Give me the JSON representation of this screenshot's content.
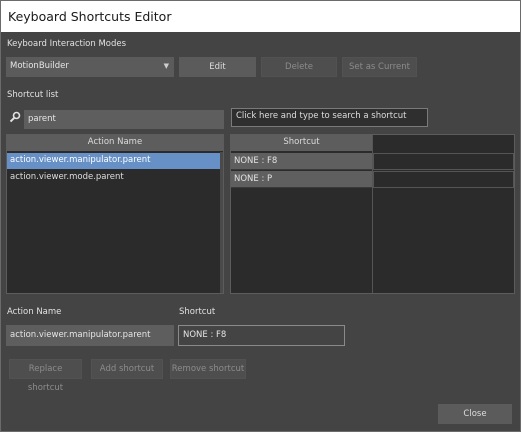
{
  "window": {
    "title": "Keyboard Shortcuts Editor"
  },
  "modes": {
    "label": "Keyboard Interaction Modes",
    "selected": "MotionBuilder",
    "edit_label": "Edit",
    "delete_label": "Delete",
    "set_current_label": "Set as Current"
  },
  "shortcut_list": {
    "label": "Shortcut list",
    "filter_value": "parent",
    "search_placeholder": "Click here and type to search a shortcut",
    "action_header": "Action Name",
    "shortcut_header": "Shortcut",
    "rows": [
      {
        "action": "action.viewer.manipulator.parent",
        "shortcut": "NONE : F8"
      },
      {
        "action": "action.viewer.mode.parent",
        "shortcut": "NONE : P"
      }
    ]
  },
  "details": {
    "action_label": "Action Name",
    "action_value": "action.viewer.manipulator.parent",
    "shortcut_label": "Shortcut",
    "shortcut_value": "NONE : F8"
  },
  "actions": {
    "replace_label": "Replace shortcut",
    "add_label": "Add shortcut",
    "remove_label": "Remove shortcut",
    "close_label": "Close"
  }
}
